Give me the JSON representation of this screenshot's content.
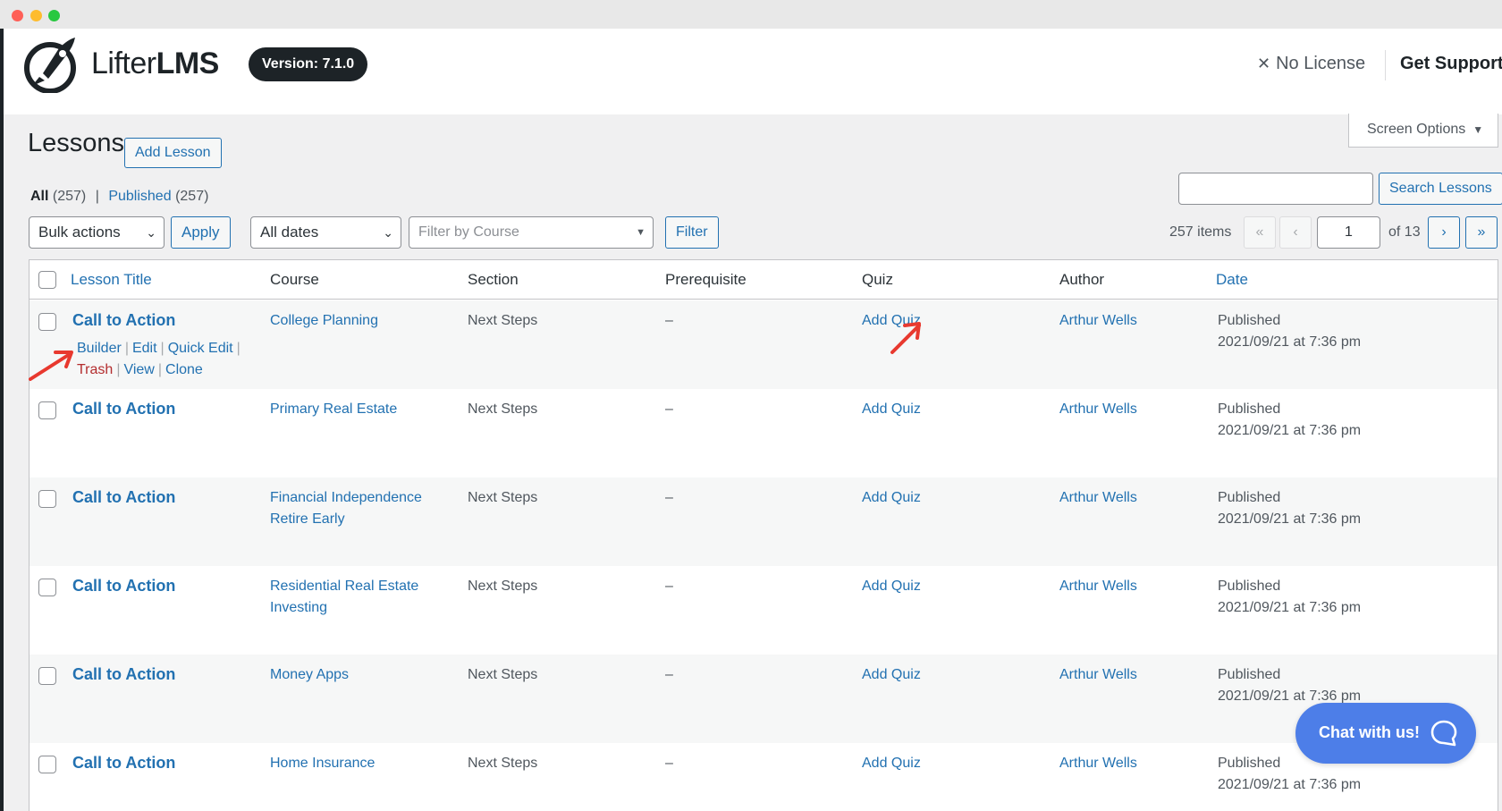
{
  "header": {
    "brand_main": "Lifter",
    "brand_bold": "LMS",
    "version": "Version: 7.1.0",
    "no_license": "No License",
    "get_support": "Get Support"
  },
  "screen_options": "Screen Options",
  "page_title": "Lessons",
  "add_lesson": "Add Lesson",
  "views": {
    "all": "All",
    "all_count": "(257)",
    "separator": "|",
    "published": "Published",
    "published_count": "(257)"
  },
  "search": {
    "button": "Search Lessons",
    "value": ""
  },
  "tablenav": {
    "bulk_actions": "Bulk actions",
    "apply": "Apply",
    "all_dates": "All dates",
    "course_placeholder": "Filter by Course",
    "filter": "Filter",
    "items": "257 items",
    "first": "«",
    "prev": "‹",
    "current_page": "1",
    "of_total": "of 13",
    "next": "›",
    "last": "»"
  },
  "columns": {
    "title": "Lesson Title",
    "course": "Course",
    "section": "Section",
    "prerequisite": "Prerequisite",
    "quiz": "Quiz",
    "author": "Author",
    "date": "Date"
  },
  "row_actions": {
    "builder": "Builder",
    "edit": "Edit",
    "quick_edit": "Quick Edit",
    "trash": "Trash",
    "view": "View",
    "clone": "Clone",
    "sep": "|"
  },
  "rows": [
    {
      "title": "Call to Action",
      "course": "College Planning",
      "course2": "",
      "section": "Next Steps",
      "prereq": "–",
      "quiz": "Add Quiz",
      "author": "Arthur Wells",
      "status": "Published",
      "date": "2021/09/21 at 7:36 pm"
    },
    {
      "title": "Call to Action",
      "course": "Primary Real Estate",
      "course2": "",
      "section": "Next Steps",
      "prereq": "–",
      "quiz": "Add Quiz",
      "author": "Arthur Wells",
      "status": "Published",
      "date": "2021/09/21 at 7:36 pm"
    },
    {
      "title": "Call to Action",
      "course": "Financial Independence",
      "course2": "Retire Early",
      "section": "Next Steps",
      "prereq": "–",
      "quiz": "Add Quiz",
      "author": "Arthur Wells",
      "status": "Published",
      "date": "2021/09/21 at 7:36 pm"
    },
    {
      "title": "Call to Action",
      "course": "Residential Real Estate",
      "course2": "Investing",
      "section": "Next Steps",
      "prereq": "–",
      "quiz": "Add Quiz",
      "author": "Arthur Wells",
      "status": "Published",
      "date": "2021/09/21 at 7:36 pm"
    },
    {
      "title": "Call to Action",
      "course": "Money Apps",
      "course2": "",
      "section": "Next Steps",
      "prereq": "–",
      "quiz": "Add Quiz",
      "author": "Arthur Wells",
      "status": "Published",
      "date": "2021/09/21 at 7:36 pm"
    },
    {
      "title": "Call to Action",
      "course": "Home Insurance",
      "course2": "",
      "section": "Next Steps",
      "prereq": "–",
      "quiz": "Add Quiz",
      "author": "Arthur Wells",
      "status": "Published",
      "date": "2021/09/21 at 7:36 pm"
    }
  ],
  "chat": {
    "label": "Chat with us!"
  },
  "colors": {
    "link": "#2271b1",
    "trash": "#b32d2e",
    "chat": "#4d7ee8",
    "annotation_arrow": "#e8392f"
  }
}
